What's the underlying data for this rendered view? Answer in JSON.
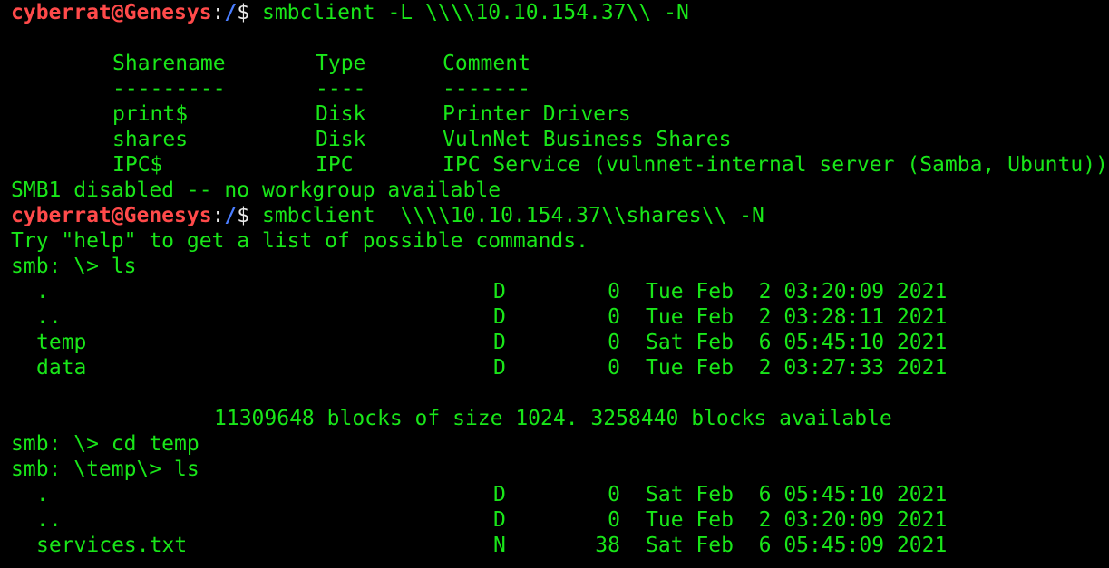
{
  "colors": {
    "background": "#000000",
    "output_green": "#19e619",
    "prompt_user_red": "#ff4a4a",
    "prompt_path_blue": "#4a7dff"
  },
  "prompt": {
    "user_host": "cyberrat@Genesys",
    "colon": ":",
    "path": "/",
    "dollar": "$"
  },
  "commands": {
    "list_shares": " smbclient -L \\\\\\\\10.10.154.37\\\\ -N",
    "connect_share": " smbclient  \\\\\\\\10.10.154.37\\\\shares\\\\ -N"
  },
  "shares_table": {
    "headers": [
      "Sharename",
      "Type",
      "Comment"
    ],
    "separators": [
      "---------",
      "----",
      "-------"
    ],
    "rows": [
      [
        "print$",
        "Disk",
        "Printer Drivers"
      ],
      [
        "shares",
        "Disk",
        "VulnNet Business Shares"
      ],
      [
        "IPC$",
        "IPC",
        "IPC Service (vulnnet-internal server (Samba, Ubuntu))"
      ]
    ],
    "smb1_notice": "SMB1 disabled -- no workgroup available"
  },
  "help_hint": "Try \"help\" to get a list of possible commands.",
  "smb_prompts": {
    "ls_root": "smb: \\> ls",
    "cd_temp": "smb: \\> cd temp",
    "ls_temp": "smb: \\temp\\> ls"
  },
  "root_listing": [
    {
      "name": ".",
      "attr": "D",
      "size": "0",
      "date": "Tue Feb  2 03:20:09 2021"
    },
    {
      "name": "..",
      "attr": "D",
      "size": "0",
      "date": "Tue Feb  2 03:28:11 2021"
    },
    {
      "name": "temp",
      "attr": "D",
      "size": "0",
      "date": "Sat Feb  6 05:45:10 2021"
    },
    {
      "name": "data",
      "attr": "D",
      "size": "0",
      "date": "Tue Feb  2 03:27:33 2021"
    }
  ],
  "blocks_info": "11309648 blocks of size 1024. 3258440 blocks available",
  "temp_listing": [
    {
      "name": ".",
      "attr": "D",
      "size": "0",
      "date": "Sat Feb  6 05:45:10 2021"
    },
    {
      "name": "..",
      "attr": "D",
      "size": "0",
      "date": "Tue Feb  2 03:20:09 2021"
    },
    {
      "name": "services.txt",
      "attr": "N",
      "size": "38",
      "date": "Sat Feb  6 05:45:09 2021"
    }
  ]
}
